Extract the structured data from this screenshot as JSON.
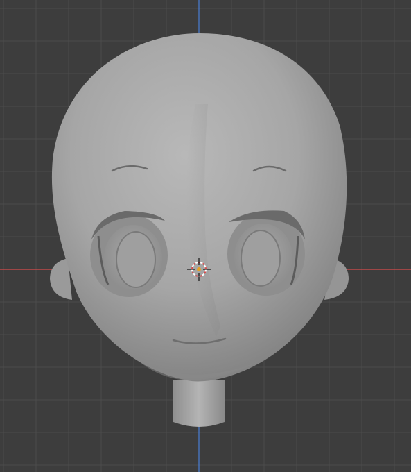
{
  "viewport": {
    "background": "#3d3d3d",
    "grid_color": "#4b4b4b",
    "x_axis_color": "#d94b4b",
    "z_axis_color": "#4a7fd6"
  },
  "model": {
    "object": "head-mesh",
    "shading": "solid",
    "base_color": "#a9a9a9"
  },
  "cursor": {
    "icon": "3d-cursor-icon",
    "ring_colors": [
      "#d94b4b",
      "#ffffff"
    ],
    "center_color": "#e8a020"
  }
}
